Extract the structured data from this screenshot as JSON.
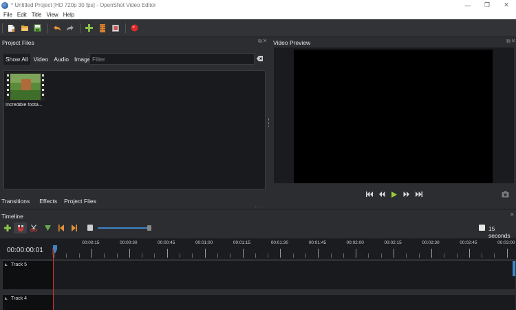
{
  "window": {
    "title": "* Untitled Project [HD 720p 30 fps] - OpenShot Video Editor",
    "minimize": "—",
    "restore": "❐",
    "close": "✕"
  },
  "menu": [
    "File",
    "Edit",
    "Title",
    "View",
    "Help"
  ],
  "toolbar_icons": [
    "new-project-icon",
    "open-project-icon",
    "save-project-icon",
    "undo-icon",
    "redo-icon",
    "import-files-icon",
    "choose-profile-icon",
    "fullscreen-icon",
    "export-video-icon"
  ],
  "project_files": {
    "title": "Project Files",
    "dock_buttons": "⧉✕",
    "tabs": [
      "Show All",
      "Video",
      "Audio",
      "Image"
    ],
    "active_tab": "Show All",
    "filter_placeholder": "Filter",
    "files": [
      {
        "label": "Incredible foota..."
      }
    ]
  },
  "bottom_tabs": [
    "Transitions",
    "Effects",
    "Project Files"
  ],
  "video_preview": {
    "title": "Video Preview",
    "dock_buttons": "⧉✕",
    "controls": [
      "jump-start-icon",
      "rewind-icon",
      "play-icon",
      "fast-forward-icon",
      "jump-end-icon"
    ]
  },
  "timeline": {
    "title": "Timeline",
    "dock_buttons": "✕",
    "current_time": "00:00:00:01",
    "zoom_label": "15 seconds",
    "ticks": [
      "00:00:15",
      "00:00:30",
      "00:00:45",
      "00:01:00",
      "00:01:15",
      "00:01:30",
      "00:01:45",
      "00:02:00",
      "00:02:15",
      "00:02:30",
      "00:02:45",
      "00:03:00"
    ],
    "tracks": [
      {
        "name": "Track 5"
      },
      {
        "name": "Track 4"
      }
    ]
  },
  "colors": {
    "background": "#2b2d31",
    "panel_dark": "#191a1d",
    "accent_blue": "#3d85c6",
    "playhead_red": "#e03030",
    "play_green": "#9ccc3c"
  }
}
